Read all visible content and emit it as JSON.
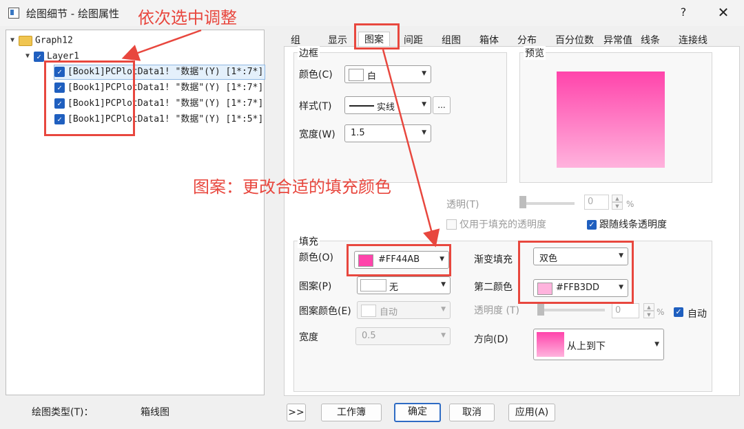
{
  "window": {
    "title": "绘图细节 - 绘图属性",
    "help": "?",
    "close": "✕"
  },
  "tree": {
    "root": "Graph12",
    "layer": "Layer1",
    "items": [
      "[Book1]PCPlotData1! \"数据\"(Y) [1*:7*]",
      "[Book1]PCPlotData1! \"数据\"(Y) [1*:7*]",
      "[Book1]PCPlotData1! \"数据\"(Y) [1*:7*]",
      "[Book1]PCPlotData1! \"数据\"(Y) [1*:5*]"
    ]
  },
  "plot_type": {
    "label": "绘图类型(T)：",
    "value": "箱线图"
  },
  "tabs": [
    "组",
    "显示",
    "图案",
    "间距",
    "组图",
    "箱体",
    "分布",
    "百分位数",
    "异常值",
    "线条",
    "连接线"
  ],
  "border": {
    "title": "边框",
    "color_label": "颜色(C)",
    "color_value": "白",
    "style_label": "样式(T)",
    "style_value": "实线",
    "style_more": "...",
    "width_label": "宽度(W)",
    "width_value": "1.5"
  },
  "preview": {
    "title": "预览",
    "gradient_top": "#FF44AB",
    "gradient_bottom": "#FFB3DD"
  },
  "transparency": {
    "label": "透明(T)",
    "value": "0",
    "unit": "%",
    "fill_only": "仅用于填充的透明度",
    "follow_line": "跟随线条透明度"
  },
  "fill": {
    "title": "填充",
    "color_label": "颜色(O)",
    "color_value": "#FF44AB",
    "color_hex": "#FF44AB",
    "pattern_label": "图案(P)",
    "pattern_value": "无",
    "pattern_color_label": "图案颜色(E)",
    "pattern_color_value": "自动",
    "width_label": "宽度",
    "width_value": "0.5",
    "gradient_label": "渐变填充",
    "gradient_value": "双色",
    "second_color_label": "第二颜色",
    "second_color_value": "#FFB3DD",
    "second_color_hex": "#FFB3DD",
    "opacity_label": "透明度 (T)",
    "opacity_value": "0",
    "opacity_unit": "%",
    "auto_label": "自动",
    "direction_label": "方向(D)",
    "direction_value": "从上到下"
  },
  "buttons": {
    "expand": ">>",
    "workbook": "工作簿",
    "ok": "确定",
    "cancel": "取消",
    "apply": "应用(A)"
  },
  "annotations": {
    "top": "依次选中调整",
    "middle": "图案：更改合适的填充颜色"
  },
  "colors": {
    "accent": "#1f5fbf",
    "annotation": "#e8473e"
  }
}
